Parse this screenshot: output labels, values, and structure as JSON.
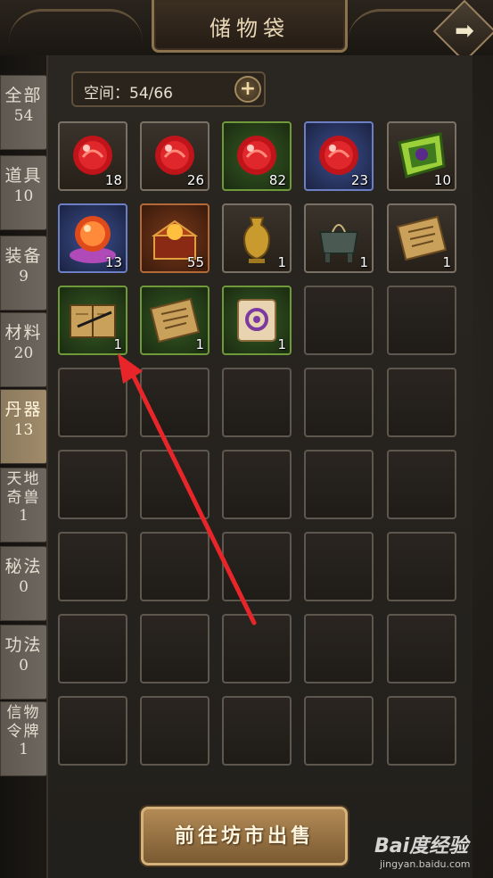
{
  "window": {
    "title": "储物袋"
  },
  "nav": {
    "next_icon": "right-arrow-icon"
  },
  "tabs": [
    {
      "label": "全部",
      "count": "54",
      "active": false
    },
    {
      "label": "道具",
      "count": "10",
      "active": false
    },
    {
      "label": "装备",
      "count": "9",
      "active": false
    },
    {
      "label": "材料",
      "count": "20",
      "active": false
    },
    {
      "label": "丹器",
      "count": "13",
      "active": true
    },
    {
      "label": "天地奇兽",
      "count": "1",
      "active": false
    },
    {
      "label": "秘法",
      "count": "0",
      "active": false
    },
    {
      "label": "功法",
      "count": "0",
      "active": false
    },
    {
      "label": "信物令牌",
      "count": "1",
      "active": false
    }
  ],
  "capacity": {
    "text": "空间：54/66",
    "expand_icon": "plus-icon"
  },
  "items": [
    {
      "icon": "red-orb-icon",
      "quality": "grey",
      "qty": "18"
    },
    {
      "icon": "red-orb-icon",
      "quality": "grey",
      "qty": "26"
    },
    {
      "icon": "red-orb-icon",
      "quality": "green",
      "qty": "82"
    },
    {
      "icon": "red-orb-icon",
      "quality": "blue",
      "qty": "23"
    },
    {
      "icon": "green-talisman-icon",
      "quality": "grey",
      "qty": "10"
    },
    {
      "icon": "crystal-ball-icon",
      "quality": "blue",
      "qty": "13"
    },
    {
      "icon": "treasure-chest-icon",
      "quality": "orange",
      "qty": "55"
    },
    {
      "icon": "golden-vase-icon",
      "quality": "grey",
      "qty": "1"
    },
    {
      "icon": "bronze-cauldron-icon",
      "quality": "grey",
      "qty": "1"
    },
    {
      "icon": "scroll-icon",
      "quality": "grey",
      "qty": "1"
    },
    {
      "icon": "book-brush-icon",
      "quality": "green",
      "qty": "1"
    },
    {
      "icon": "scroll-icon",
      "quality": "green",
      "qty": "1"
    },
    {
      "icon": "purple-seal-scroll-icon",
      "quality": "green",
      "qty": "1"
    }
  ],
  "empty_slots": 27,
  "colors": {
    "grey": "#7a7166",
    "green": "#6e9a3a",
    "blue": "#6d7fc4",
    "orange": "#b46a36",
    "annotation": "#e8262a"
  },
  "footer": {
    "sell_label": "前往坊市出售"
  },
  "watermark": {
    "logo": "Bai度经验",
    "url": "jingyan.baidu.com"
  }
}
